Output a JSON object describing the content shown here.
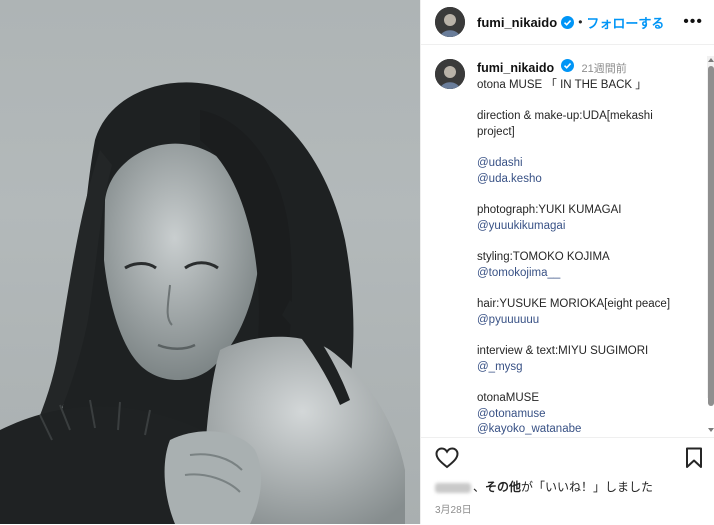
{
  "header": {
    "username": "fumi_nikaido",
    "separator": "•",
    "follow_label": "フォローする",
    "more_label": "•••"
  },
  "caption": {
    "username": "fumi_nikaido",
    "time": "21週間前",
    "lines": [
      "otona MUSE 「 IN THE BACK 」",
      "",
      "direction & make-up:UDA[mekashi project]",
      "",
      "@udashi",
      "@uda.kesho",
      "",
      "photograph:YUKI KUMAGAI",
      "@yuuukikumagai",
      "",
      "styling:TOMOKO KOJIMA",
      "@tomokojima__",
      "",
      "hair:YUSUKE MORIOKA[eight peace]",
      "@pyuuuuuu",
      "",
      "interview & text:MIYU SUGIMORI",
      "@_mysg",
      "",
      "otonaMUSE",
      "@otonamuse",
      "@kayoko_watanabe"
    ]
  },
  "actions": {
    "likes_prefix": "、",
    "likes_bold": "その他",
    "likes_suffix": "が「いいね！」しました",
    "date": "3月28日"
  },
  "icons": {
    "verified": "verified-badge-icon",
    "heart": "heart-icon",
    "bookmark": "bookmark-icon",
    "more": "more-options-icon"
  },
  "colors": {
    "link": "#385185",
    "follow": "#0095f6",
    "verified": "#0095f6"
  }
}
